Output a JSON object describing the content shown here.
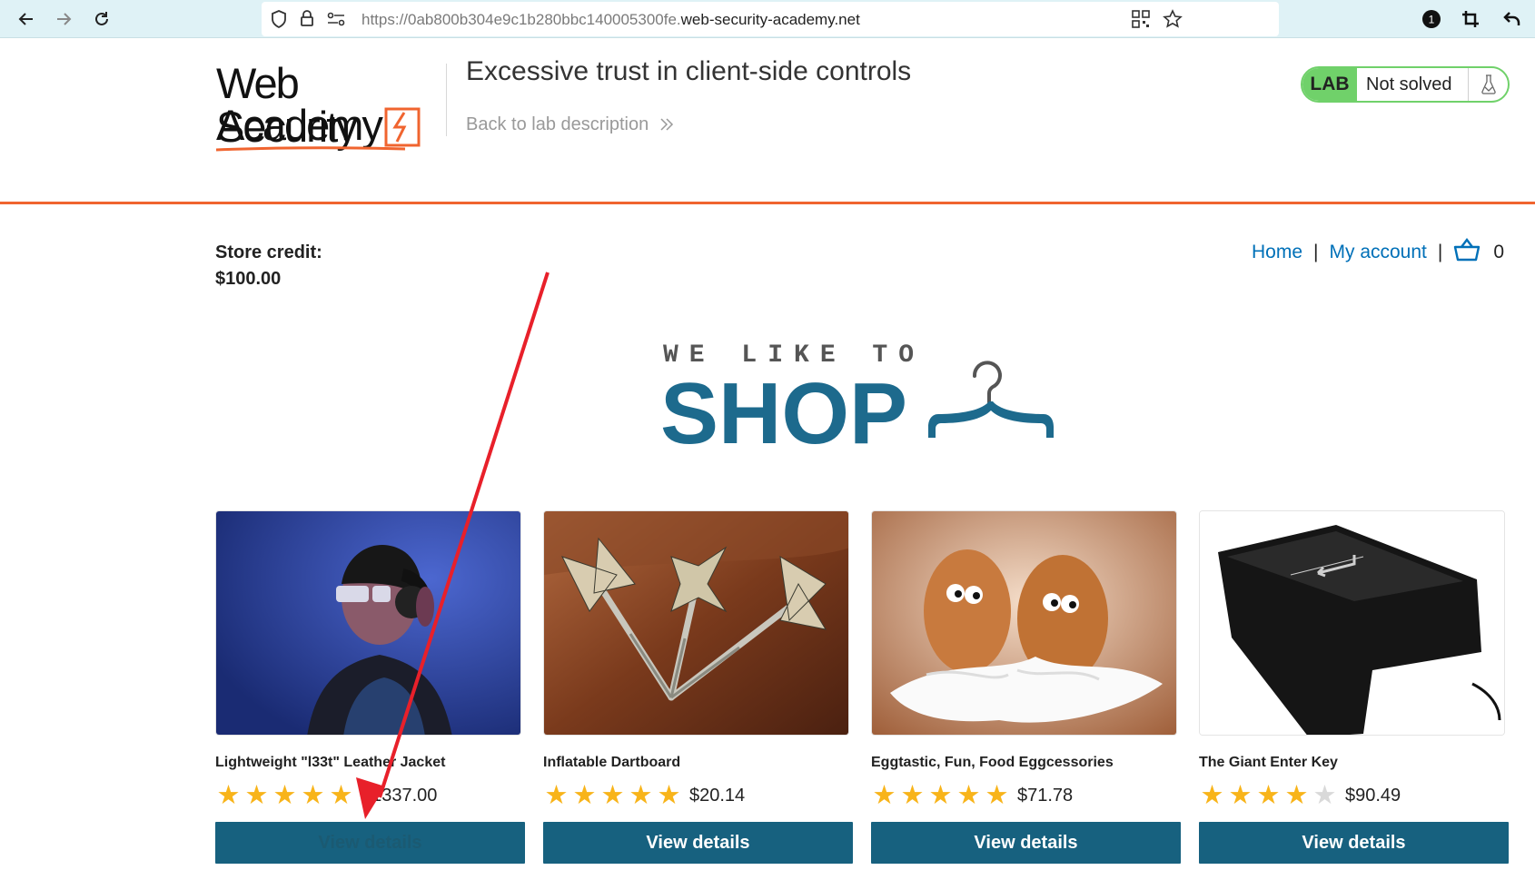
{
  "browser": {
    "url_prefix": "https://0ab800b304e9c1b280bbc140005300fe.",
    "url_host": "web-security-academy.net",
    "notification_count": "1"
  },
  "header": {
    "logo_line1": "Web Security",
    "logo_line2": "Academy",
    "lab_title": "Excessive trust in client-side controls",
    "back_link": "Back to lab description",
    "lab_label": "LAB",
    "lab_status": "Not solved"
  },
  "store": {
    "credit_label": "Store credit:",
    "credit_value": "$100.00",
    "nav": {
      "home": "Home",
      "separator": "|",
      "my_account": "My account",
      "cart_count": "0"
    }
  },
  "banner": {
    "line1": "WE LIKE TO",
    "line2": "SHOP"
  },
  "products": [
    {
      "name": "Lightweight \"l33t\" Leather Jacket",
      "price": "$1337.00",
      "rating": 5,
      "button": "View details",
      "image": "person-headphones-photo"
    },
    {
      "name": "Inflatable Dartboard",
      "price": "$20.14",
      "rating": 5,
      "button": "View details",
      "image": "darts-photo"
    },
    {
      "name": "Eggtastic, Fun, Food Eggcessories",
      "price": "$71.78",
      "rating": 5,
      "button": "View details",
      "image": "eggs-photo"
    },
    {
      "name": "The Giant Enter Key",
      "price": "$90.49",
      "rating": 4,
      "button": "View details",
      "image": "enter-key-photo"
    }
  ],
  "colors": {
    "accent": "#f0642f",
    "button": "#17617f",
    "link": "#0070b8",
    "lab_green": "#70d16a",
    "star": "#f8b41a",
    "annotation_arrow": "#e8202a"
  }
}
